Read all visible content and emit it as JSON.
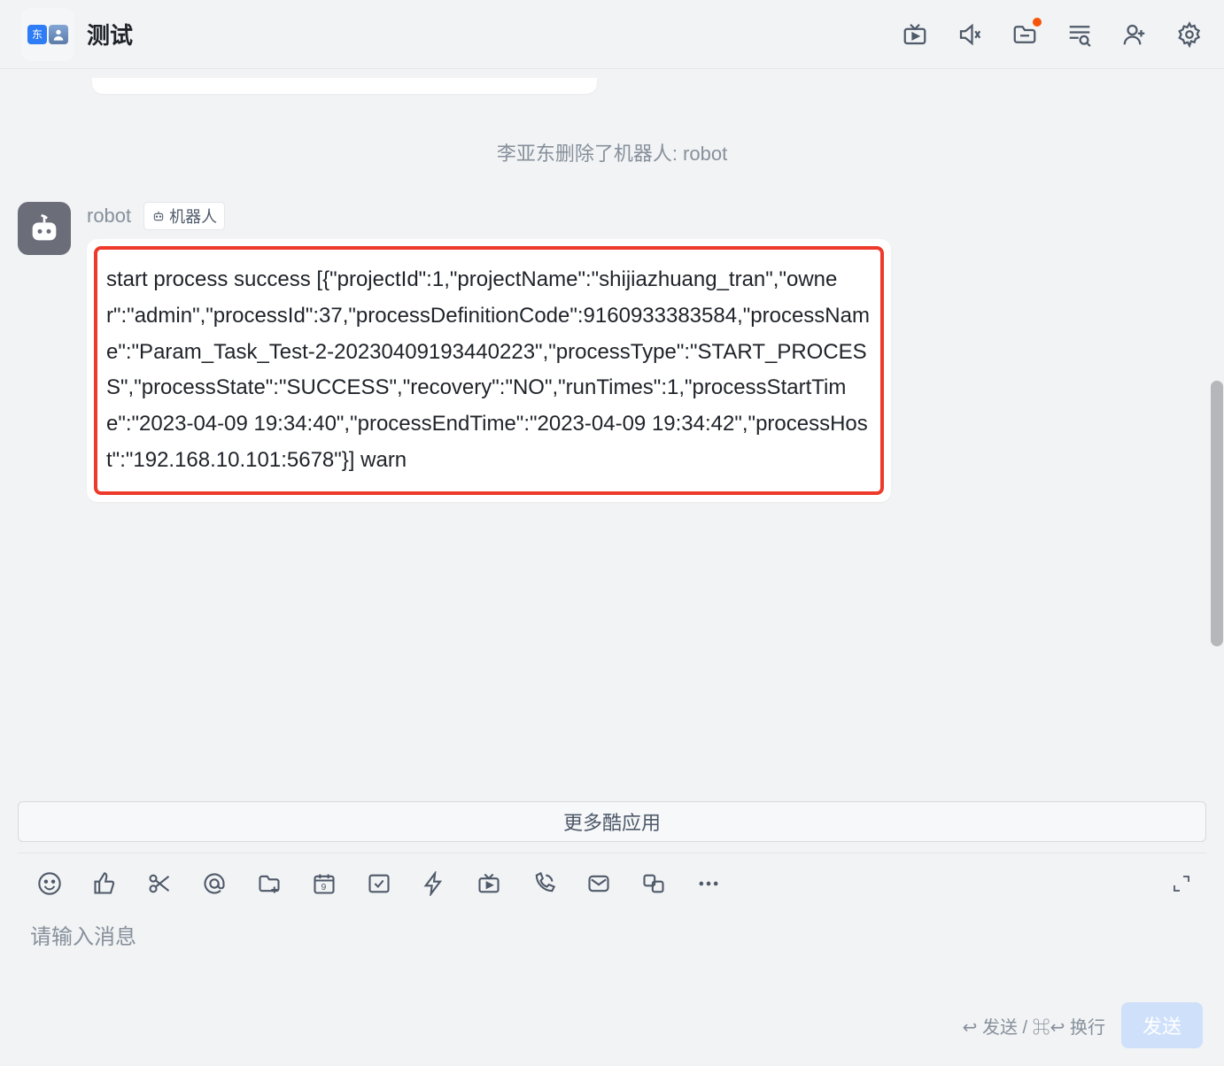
{
  "header": {
    "title": "测试",
    "avatar_initial": "东"
  },
  "system_message": "李亚东删除了机器人: robot",
  "message": {
    "sender": "robot",
    "badge": "机器人",
    "content": "start process success [{\"projectId\":1,\"projectName\":\"shijiazhuang_tran\",\"owner\":\"admin\",\"processId\":37,\"processDefinitionCode\":9160933383584,\"processName\":\"Param_Task_Test-2-20230409193440223\",\"processType\":\"START_PROCESS\",\"processState\":\"SUCCESS\",\"recovery\":\"NO\",\"runTimes\":1,\"processStartTime\":\"2023-04-09 19:34:40\",\"processEndTime\":\"2023-04-09 19:34:42\",\"processHost\":\"192.168.10.101:5678\"}] warn"
  },
  "more_apps_label": "更多酷应用",
  "input": {
    "placeholder": "请输入消息"
  },
  "footer": {
    "hint": "↩ 发送 / ⌘↩ 换行",
    "send_label": "发送"
  }
}
